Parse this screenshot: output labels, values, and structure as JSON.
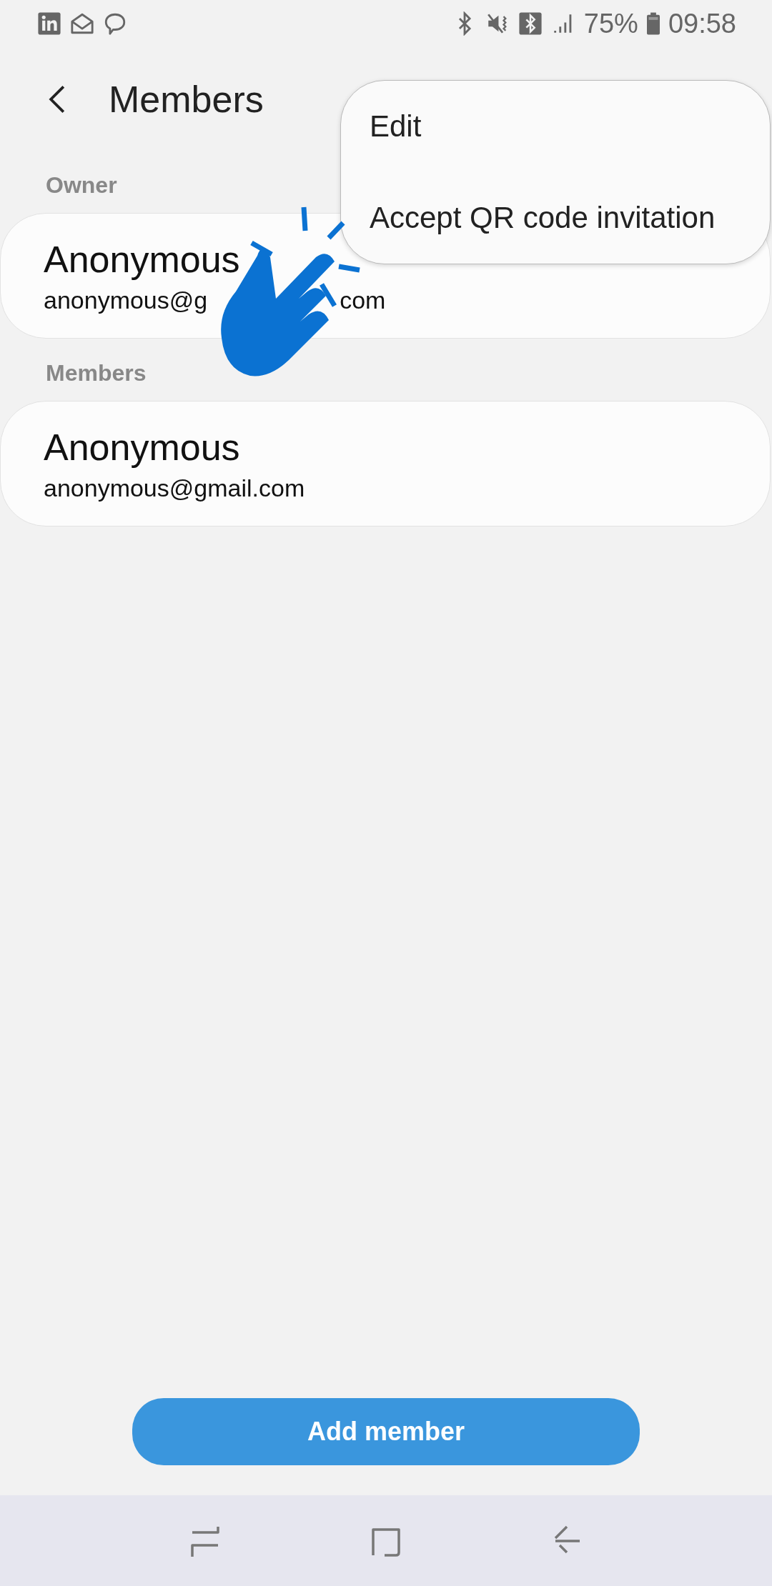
{
  "status_bar": {
    "battery": "75%",
    "time": "09:58"
  },
  "header": {
    "title": "Members"
  },
  "menu": {
    "items": [
      {
        "label": "Edit"
      },
      {
        "label": "Accept QR code invitation"
      }
    ]
  },
  "sections": [
    {
      "label": "Owner",
      "members": [
        {
          "name": "Anonymous",
          "email": "anonymous@g",
          "email_tail": "com"
        }
      ]
    },
    {
      "label": "Members",
      "members": [
        {
          "name": "Anonymous",
          "email": "anonymous@gmail.com"
        }
      ]
    }
  ],
  "add_button": {
    "label": "Add member"
  }
}
